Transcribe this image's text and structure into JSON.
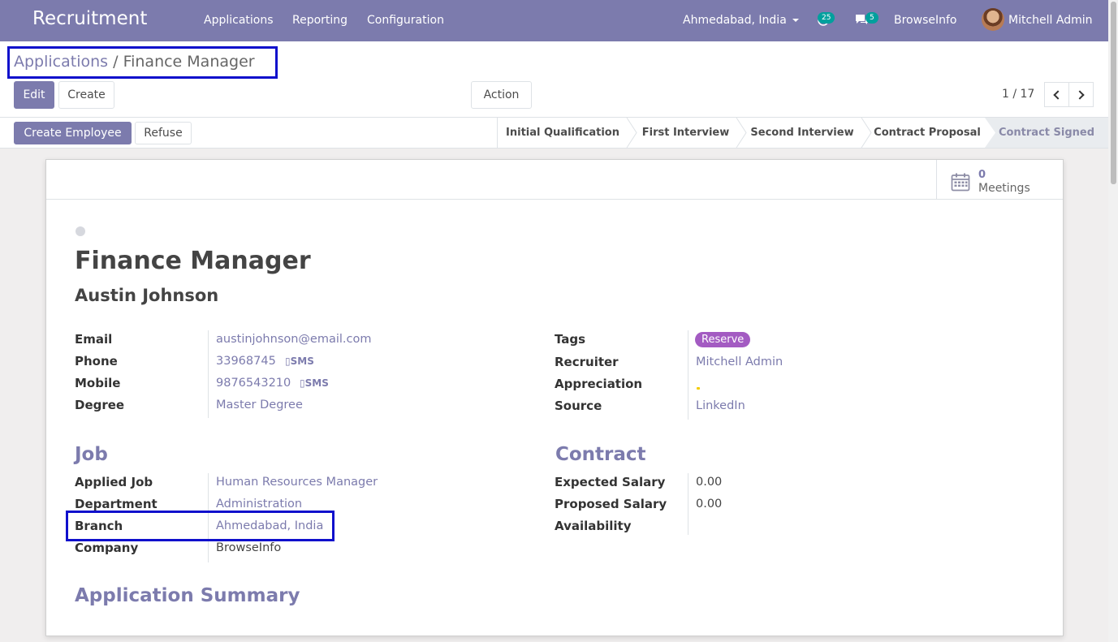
{
  "navbar": {
    "app_title": "Recruitment",
    "menus": [
      "Applications",
      "Reporting",
      "Configuration"
    ],
    "branch": "Ahmedabad, India",
    "activity_count": "25",
    "message_count": "5",
    "company": "BrowseInfo",
    "user": "Mitchell Admin",
    "accent_color": "#7c7bad",
    "badge_color": "#00a09d"
  },
  "breadcrumb": {
    "parent": "Applications",
    "separator": "/",
    "current": "Finance Manager"
  },
  "toolbar": {
    "edit": "Edit",
    "create": "Create",
    "action": "Action",
    "pager": "1 / 17"
  },
  "statusbar": {
    "create_employee": "Create Employee",
    "refuse": "Refuse",
    "stages": [
      "Initial Qualification",
      "First Interview",
      "Second Interview",
      "Contract Proposal",
      "Contract Signed"
    ],
    "active_stage": "Contract Signed"
  },
  "meetings": {
    "count": "0",
    "label": "Meetings",
    "icon": "calendar-icon"
  },
  "record": {
    "title": "Finance Manager",
    "applicant": "Austin Johnson",
    "left_fields": [
      {
        "label": "Email",
        "value": "austinjohnson@email.com"
      },
      {
        "label": "Phone",
        "value": "33968745"
      },
      {
        "label": "Mobile",
        "value": "9876543210"
      },
      {
        "label": "Degree",
        "value": "Master Degree"
      }
    ],
    "sms_label": "SMS",
    "right_fields": {
      "tags_label": "Tags",
      "tag": "Reserve",
      "recruiter_label": "Recruiter",
      "recruiter": "Mitchell Admin",
      "appreciation_label": "Appreciation",
      "source_label": "Source",
      "source": "LinkedIn"
    },
    "job_section": {
      "title": "Job",
      "fields": [
        {
          "label": "Applied Job",
          "value": "Human Resources Manager"
        },
        {
          "label": "Department",
          "value": "Administration"
        },
        {
          "label": "Branch",
          "value": "Ahmedabad, India"
        },
        {
          "label": "Company",
          "value": "BrowseInfo"
        }
      ]
    },
    "contract_section": {
      "title": "Contract",
      "fields": [
        {
          "label": "Expected Salary",
          "value": "0.00"
        },
        {
          "label": "Proposed Salary",
          "value": "0.00"
        },
        {
          "label": "Availability",
          "value": ""
        }
      ]
    },
    "summary_title": "Application Summary"
  }
}
